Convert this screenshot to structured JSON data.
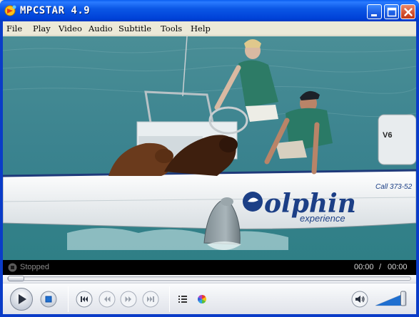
{
  "window": {
    "title": "MPCSTAR 4.9",
    "minimize_label": "Minimize",
    "maximize_label": "Maximize",
    "close_label": "Close"
  },
  "menu": {
    "items": [
      {
        "label": "File"
      },
      {
        "label": "Play"
      },
      {
        "label": "Video"
      },
      {
        "label": "Audio"
      },
      {
        "label": "Subtitle"
      },
      {
        "label": "Tools"
      },
      {
        "label": "Help"
      }
    ]
  },
  "video": {
    "boat_brand": "olphin",
    "boat_brand_sub": "experience",
    "boat_phone": "Call 373-52",
    "engine_badge": "V6"
  },
  "status": {
    "state": "Stopped",
    "time_current": "00:00",
    "time_separator": "/",
    "time_total": "00:00"
  },
  "controls": {
    "seek_position": 0,
    "volume_level": 0.85,
    "icons": [
      "play-icon",
      "stop-icon",
      "skip-previous-icon",
      "rewind-icon",
      "fast-forward-icon",
      "skip-next-icon",
      "playlist-icon",
      "color-wheel-icon",
      "speaker-icon"
    ]
  },
  "colors": {
    "titlebar": "#0A5EF0",
    "close_button": "#D4502E",
    "seawater": "#3F8D98",
    "boat_hull": "#F2F4F5",
    "brand_text": "#1C3F86"
  }
}
